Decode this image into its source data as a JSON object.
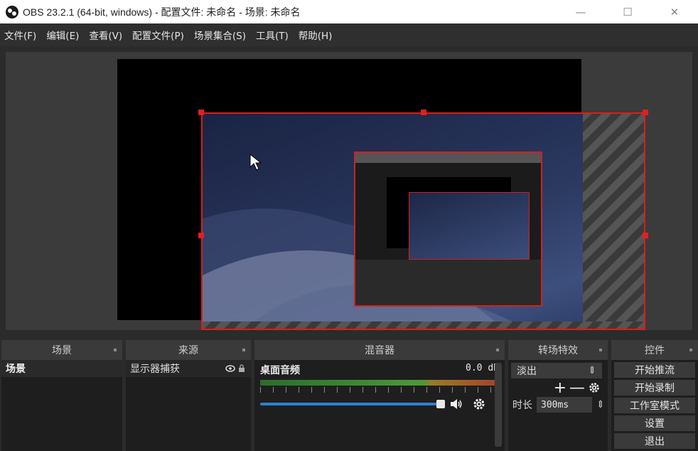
{
  "window": {
    "title": "OBS 23.2.1 (64-bit, windows) - 配置文件: 未命名 - 场景: 未命名",
    "minimize": "—",
    "maximize": "☐",
    "close": "✕"
  },
  "menu": [
    "文件(F)",
    "编辑(E)",
    "查看(V)",
    "配置文件(P)",
    "场景集合(S)",
    "工具(T)",
    "帮助(H)"
  ],
  "docks": {
    "scenes": {
      "title": "场景",
      "items": [
        "场景"
      ]
    },
    "sources": {
      "title": "来源",
      "items": [
        "显示器捕获"
      ]
    },
    "mixer": {
      "title": "混音器",
      "track_name": "桌面音频",
      "track_db": "0.0 dB",
      "volume_percent": 100
    },
    "transitions": {
      "title": "转场特效",
      "selected": "淡出",
      "duration_label": "时长",
      "duration_value": "300ms"
    },
    "controls": {
      "title": "控件",
      "buttons": [
        "开始推流",
        "开始录制",
        "工作室模式",
        "设置",
        "退出"
      ]
    }
  },
  "colors": {
    "selection": "#d81e1e",
    "volume": "#2d7fd3",
    "meter_green": "#4a9a3a",
    "meter_red": "#a3432a"
  },
  "icons": [
    "obs-logo-icon",
    "cursor-icon",
    "eye-icon",
    "lock-icon",
    "speaker-icon",
    "gear-icon",
    "plus-icon",
    "minus-icon"
  ]
}
